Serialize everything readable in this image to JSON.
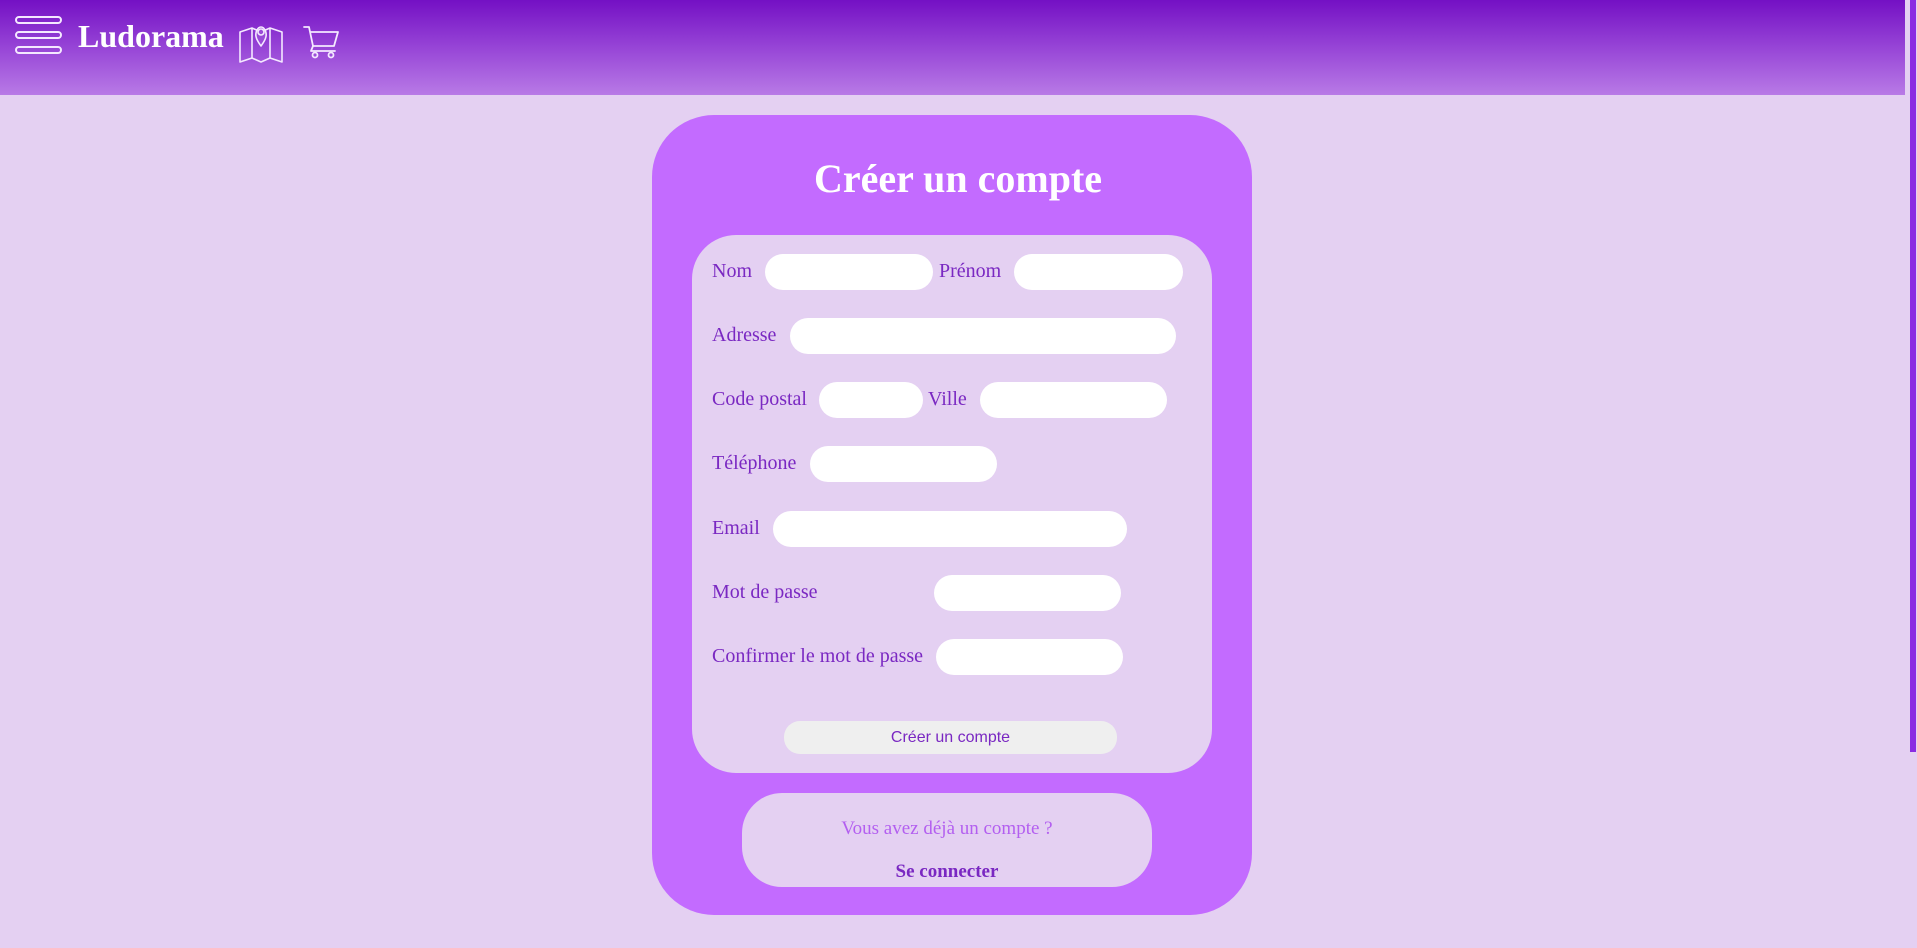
{
  "header": {
    "brand": "Ludorama",
    "menu_icon": "hamburger-menu-icon",
    "map_icon": "map-pin-icon",
    "cart_icon": "shopping-cart-icon"
  },
  "form": {
    "title": "Créer un compte",
    "fields": {
      "nom": {
        "label": "Nom",
        "value": ""
      },
      "prenom": {
        "label": "Prénom",
        "value": ""
      },
      "adresse": {
        "label": "Adresse",
        "value": ""
      },
      "code_postal": {
        "label": "Code postal",
        "value": ""
      },
      "ville": {
        "label": "Ville",
        "value": ""
      },
      "telephone": {
        "label": "Téléphone",
        "value": ""
      },
      "email": {
        "label": "Email",
        "value": ""
      },
      "mot_de_passe": {
        "label": "Mot de passe",
        "value": ""
      },
      "confirmer": {
        "label": "Confirmer le mot de passe",
        "value": ""
      }
    },
    "submit_label": "Créer un compte"
  },
  "login": {
    "question": "Vous avez déjà un compte ?",
    "link": "Se connecter"
  },
  "colors": {
    "page_bg": "#e4d0f2",
    "header_top": "#7410c4",
    "card_bg": "#c36bff",
    "label_text": "#7a28c2",
    "accent_light": "#b35ff0"
  }
}
